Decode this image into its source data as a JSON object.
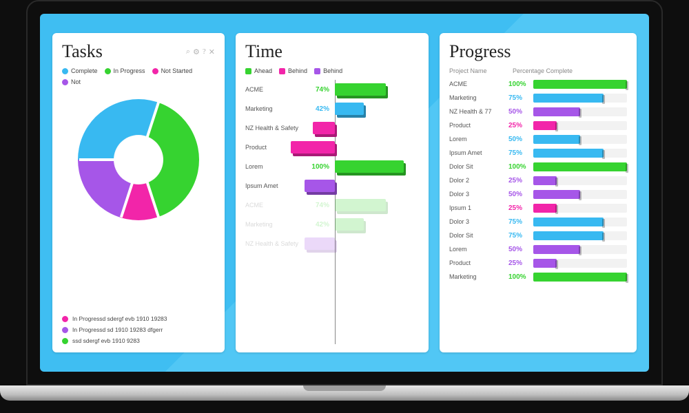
{
  "colors": {
    "blue": "#38b9f1",
    "green": "#36d330",
    "pink": "#f225a9",
    "purple": "#a656e8"
  },
  "tasks": {
    "title": "Tasks",
    "icons": [
      "search-icon",
      "gear-icon",
      "help-icon",
      "close-icon"
    ],
    "legend": [
      {
        "label": "Complete",
        "color": "blue"
      },
      {
        "label": "In Progress",
        "color": "green"
      },
      {
        "label": "Not Started",
        "color": "pink"
      },
      {
        "label": "Not",
        "color": "purple"
      }
    ],
    "bullets": [
      {
        "color": "pink",
        "text": "In Progressd sdergf evb 1910  19283"
      },
      {
        "color": "purple",
        "text": "In Progressd sd 1910  19283 dfgerr"
      },
      {
        "color": "green",
        "text": "ssd sdergf evb 1910 9283"
      }
    ]
  },
  "time": {
    "title": "Time",
    "legend": [
      {
        "label": "Ahead",
        "color": "green"
      },
      {
        "label": "Behind",
        "color": "pink"
      },
      {
        "label": "Behind",
        "color": "purple"
      }
    ]
  },
  "progress": {
    "title": "Progress",
    "headers": {
      "name": "Project Name",
      "pct": "Percentage Complete"
    }
  },
  "chart_data": [
    {
      "type": "pie",
      "title": "Tasks",
      "series": [
        {
          "name": "Complete",
          "value": 30,
          "color": "#38b9f1"
        },
        {
          "name": "In Progress",
          "value": 40,
          "color": "#36d330"
        },
        {
          "name": "Not Started",
          "value": 10,
          "color": "#f225a9"
        },
        {
          "name": "Not",
          "value": 20,
          "color": "#a656e8"
        }
      ]
    },
    {
      "type": "bar",
      "title": "Time",
      "orientation": "diverging-horizontal",
      "xlabel": "",
      "ylabel": "",
      "axis_at": 0,
      "rows": [
        {
          "name": "ACME",
          "value": 74,
          "side": "right",
          "color": "#36d330",
          "faded": false
        },
        {
          "name": "Marketing",
          "value": 42,
          "side": "right",
          "color": "#38b9f1",
          "faded": false
        },
        {
          "name": "NZ Health & Safety",
          "value": 32,
          "side": "left",
          "color": "#f225a9",
          "faded": false
        },
        {
          "name": "Product",
          "value": 64,
          "side": "left",
          "color": "#f225a9",
          "faded": false
        },
        {
          "name": "Lorem",
          "value": 100,
          "side": "right",
          "color": "#36d330",
          "faded": false
        },
        {
          "name": "Ipsum Amet",
          "value": 44,
          "side": "left",
          "color": "#a656e8",
          "faded": false
        },
        {
          "name": "ACME",
          "value": 74,
          "side": "right",
          "color": "#36d330",
          "faded": true
        },
        {
          "name": "Marketing",
          "value": 42,
          "side": "right",
          "color": "#36d330",
          "faded": true
        },
        {
          "name": "NZ Health & Safety",
          "value": 44,
          "side": "left",
          "color": "#a656e8",
          "faded": true
        }
      ]
    },
    {
      "type": "bar",
      "title": "Progress",
      "orientation": "horizontal",
      "xlabel": "Percentage Complete",
      "ylabel": "Project Name",
      "xlim": [
        0,
        100
      ],
      "rows": [
        {
          "name": "ACME",
          "value": 100,
          "color": "#36d330"
        },
        {
          "name": "Marketing",
          "value": 75,
          "color": "#38b9f1"
        },
        {
          "name": "NZ Health & 77",
          "value": 50,
          "color": "#a656e8"
        },
        {
          "name": "Product",
          "value": 25,
          "color": "#f225a9"
        },
        {
          "name": "Lorem",
          "value": 50,
          "color": "#38b9f1"
        },
        {
          "name": "Ipsum Amet",
          "value": 75,
          "color": "#38b9f1"
        },
        {
          "name": "Dolor Sit",
          "value": 100,
          "color": "#36d330"
        },
        {
          "name": "Dolor 2",
          "value": 25,
          "color": "#a656e8"
        },
        {
          "name": "Dolor 3",
          "value": 50,
          "color": "#a656e8"
        },
        {
          "name": "Ipsum 1",
          "value": 25,
          "color": "#f225a9"
        },
        {
          "name": "Dolor 3",
          "value": 75,
          "color": "#38b9f1"
        },
        {
          "name": "Dolor Sit",
          "value": 75,
          "color": "#38b9f1"
        },
        {
          "name": "Lorem",
          "value": 50,
          "color": "#a656e8"
        },
        {
          "name": "Product",
          "value": 25,
          "color": "#a656e8"
        },
        {
          "name": "Marketing",
          "value": 100,
          "color": "#36d330"
        }
      ]
    }
  ]
}
